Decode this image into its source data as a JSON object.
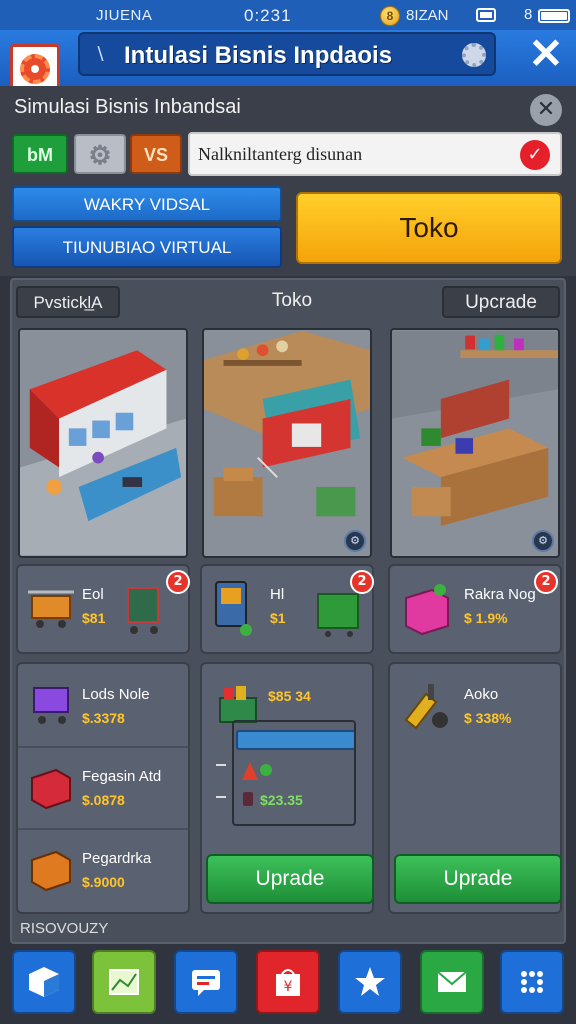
{
  "status_bar": {
    "carrier": "JIUENA",
    "time": "0:231",
    "coin_label": "8",
    "network": "8IZAN",
    "battery_level": "8"
  },
  "header": {
    "title": "Intulasi Bisnis Inpdaois"
  },
  "sub_header": {
    "title": "Simulasi Bisnis Inbandsai",
    "toolbar": {
      "btn1": "bM",
      "btn3": "VS"
    },
    "search": {
      "value": "Nalkniltanterg disunan"
    },
    "mode_a": "WAKRY VIDSAL",
    "mode_b": "TIUNUBIAO VIRTUAL",
    "toko_button": "Toko"
  },
  "main": {
    "tabs": [
      "Pvstickl̲A",
      "Toko",
      "Upcrade"
    ],
    "small_cards": [
      {
        "label": "Eol",
        "price": "$81",
        "badge": "2"
      },
      {
        "label": "Hl",
        "price": "$1",
        "badge": "2"
      },
      {
        "label": "Rakra Nog",
        "price": "$ 1.9%",
        "badge": "2"
      }
    ],
    "col1_items": [
      {
        "label": "Lods Nole",
        "price": "$.3378"
      },
      {
        "label": "Fegasin Atd",
        "price": "$.0878"
      },
      {
        "label": "Pegardrka",
        "price": "$.9000"
      }
    ],
    "col2": {
      "top_price": "$85 34",
      "bottom_price": "$23.35",
      "upgrade_label": "Uprade"
    },
    "col3": {
      "item_label": "Aoko",
      "item_price": "$ 338%",
      "upgrade_label": "Uprade"
    },
    "footer_note": "RISOVOUZY"
  },
  "nav": {
    "colors": [
      "#1f6fd8",
      "#7cc23a",
      "#1f6fd8",
      "#e0262a",
      "#1f6fd8",
      "#29a844",
      "#1f6fd8"
    ]
  }
}
